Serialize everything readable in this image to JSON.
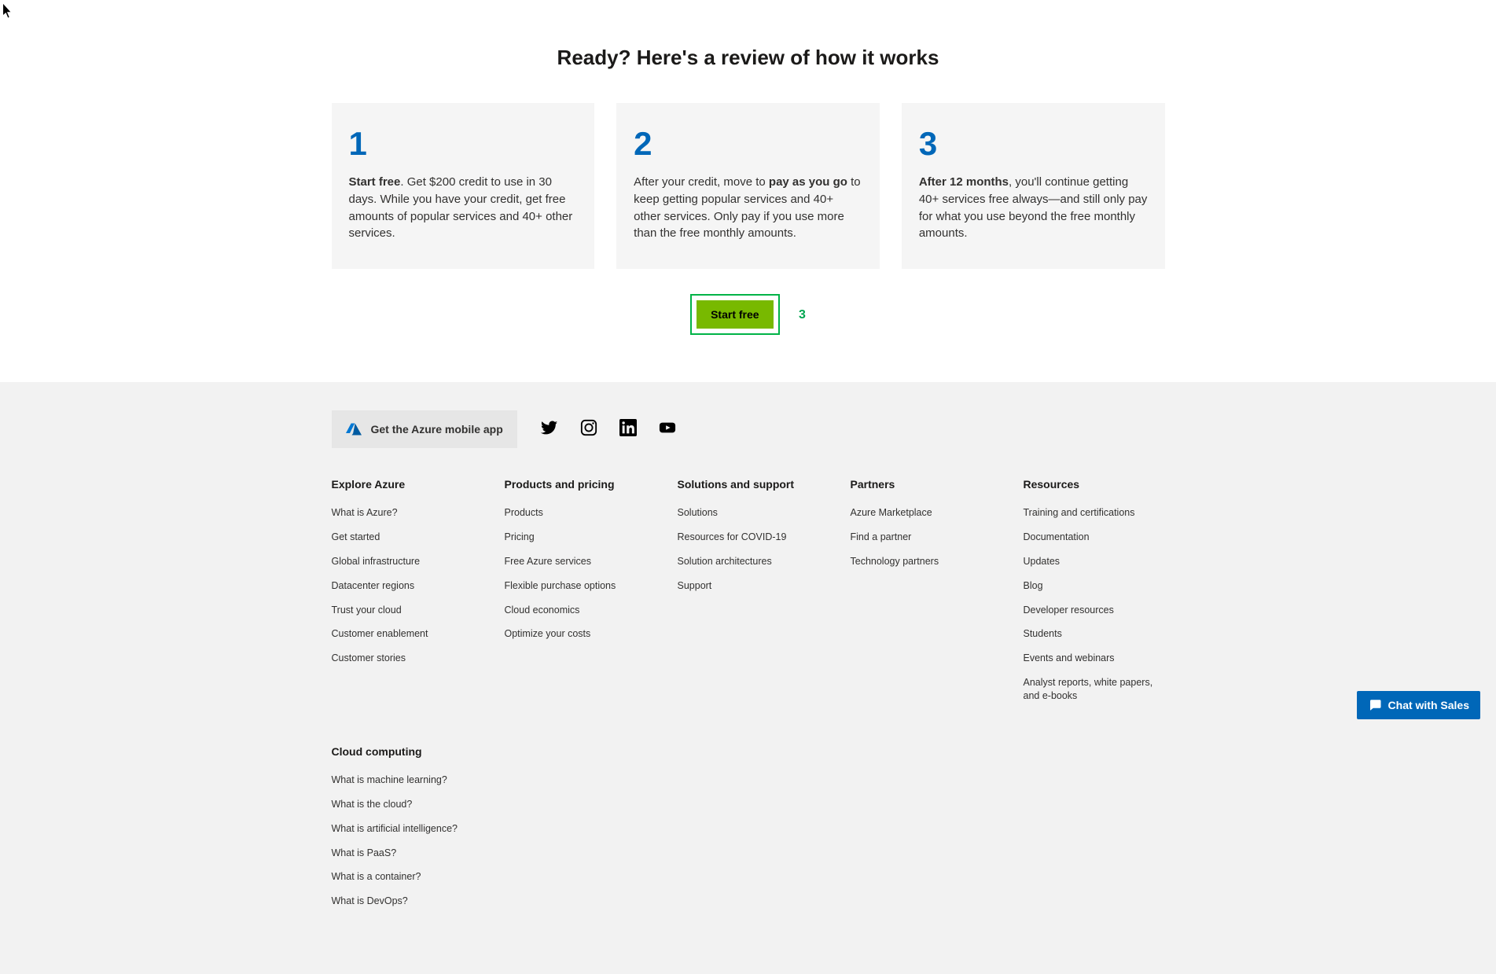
{
  "hero": {
    "title": "Ready? Here's a review of how it works"
  },
  "cards": [
    {
      "num": "1",
      "bold_lead": "Start free",
      "rest": ". Get $200 credit to use in 30 days. While you have your credit, get free amounts of popular services and 40+ other services."
    },
    {
      "num": "2",
      "pre": "After your credit, move to ",
      "bold": "pay as you go",
      "rest": " to keep getting popular services and 40+ other services. Only pay if you use more than the free monthly amounts."
    },
    {
      "num": "3",
      "pre": "",
      "bold": "After 12 months",
      "rest": ", you'll continue getting 40+ services free always—and still only pay for what you use beyond the free monthly amounts."
    }
  ],
  "cta": {
    "start_free": "Start free",
    "annotation": "3"
  },
  "mobile_app": {
    "label": "Get the Azure mobile app"
  },
  "chat": {
    "label": "Chat with Sales"
  },
  "footer_columns": [
    {
      "title": "Explore Azure",
      "links": [
        "What is Azure?",
        "Get started",
        "Global infrastructure",
        "Datacenter regions",
        "Trust your cloud",
        "Customer enablement",
        "Customer stories"
      ]
    },
    {
      "title": "Products and pricing",
      "links": [
        "Products",
        "Pricing",
        "Free Azure services",
        "Flexible purchase options",
        "Cloud economics",
        "Optimize your costs"
      ]
    },
    {
      "title": "Solutions and support",
      "links": [
        "Solutions",
        "Resources for COVID-19",
        "Solution architectures",
        "Support"
      ]
    },
    {
      "title": "Partners",
      "links": [
        "Azure Marketplace",
        "Find a partner",
        "Technology partners"
      ]
    },
    {
      "title": "Resources",
      "links": [
        "Training and certifications",
        "Documentation",
        "Updates",
        "Blog",
        "Developer resources",
        "Students",
        "Events and webinars",
        "Analyst reports, white papers, and e-books"
      ]
    },
    {
      "title": "Cloud computing",
      "links": [
        "What is machine learning?",
        "What is the cloud?",
        "What is artificial intelligence?",
        "What is PaaS?",
        "What is a container?",
        "What is DevOps?"
      ]
    }
  ]
}
